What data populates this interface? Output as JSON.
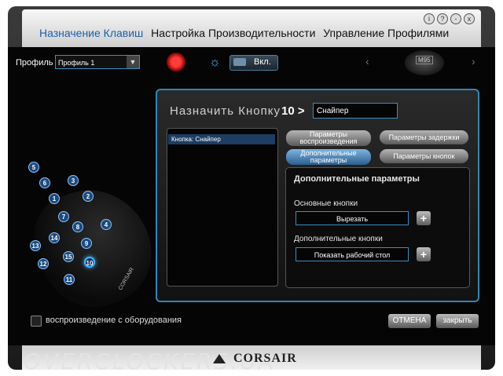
{
  "nav": {
    "tabs": [
      {
        "label": "Назначение Клавиш"
      },
      {
        "label": "Настройка Производительности"
      },
      {
        "label": "Управление Профилями"
      }
    ]
  },
  "window_controls": [
    "i",
    "?",
    "-",
    "x"
  ],
  "profile": {
    "label": "Профиль",
    "value": "Профиль 1"
  },
  "toggle": {
    "label": "Вкл."
  },
  "device": {
    "model": "M95"
  },
  "panel": {
    "title": "Назначить Кнопку",
    "key_number": "10",
    "arrow": ">",
    "key_name": "Снайпер",
    "list_item": "Кнопка: Снайпер",
    "buttons": {
      "playback": "Параметры воспроизведения",
      "delay": "Параметры задержки",
      "additional": "Дополнительные параметры",
      "buttons": "Параметры кнопок"
    },
    "sub": {
      "title": "Дополнительные параметры",
      "primary_label": "Основные кнопки",
      "primary_value": "Вырезать",
      "secondary_label": "Дополнительные кнопки",
      "secondary_value": "Показать рабочий стол"
    }
  },
  "hotspots": [
    "5",
    "6",
    "3",
    "2",
    "1",
    "7",
    "4",
    "8",
    "14",
    "9",
    "13",
    "15",
    "12",
    "10",
    "11"
  ],
  "mouse_logo": "CORSAIR",
  "footer": {
    "checkbox_label": "воспроизведение с оборудования",
    "cancel": "ОТМЕНА",
    "close": "закрыть"
  },
  "watermark": "OVERCLOCKERS.UA",
  "brand": "CORSAIR",
  "colors": {
    "accent": "#2f86b8",
    "nav_active": "#1f5fa8"
  }
}
